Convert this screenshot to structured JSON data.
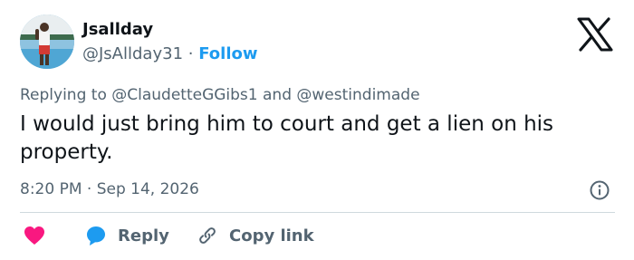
{
  "author": {
    "name": "Jsallday",
    "handle": "@JsAllday31",
    "separator": "·",
    "follow_label": "Follow"
  },
  "reply_context": {
    "prefix": "Replying to",
    "mentions": [
      "@ClaudetteGGibs1",
      "@westindimade"
    ],
    "conjunction": "and"
  },
  "tweet": {
    "text": "I would just bring him to court and get a lien on his property.",
    "time": "8:20 PM",
    "separator": "·",
    "date": "Sep 14, 2026"
  },
  "actions": {
    "reply_label": "Reply",
    "copy_link_label": "Copy link"
  },
  "colors": {
    "accent": "#1d9bf0",
    "heart": "#f91880",
    "muted": "#536471",
    "text": "#0f1419",
    "divider": "#cfd9de"
  },
  "icons": [
    "x-logo-icon",
    "info-icon",
    "heart-icon",
    "reply-bubble-icon",
    "link-icon"
  ]
}
